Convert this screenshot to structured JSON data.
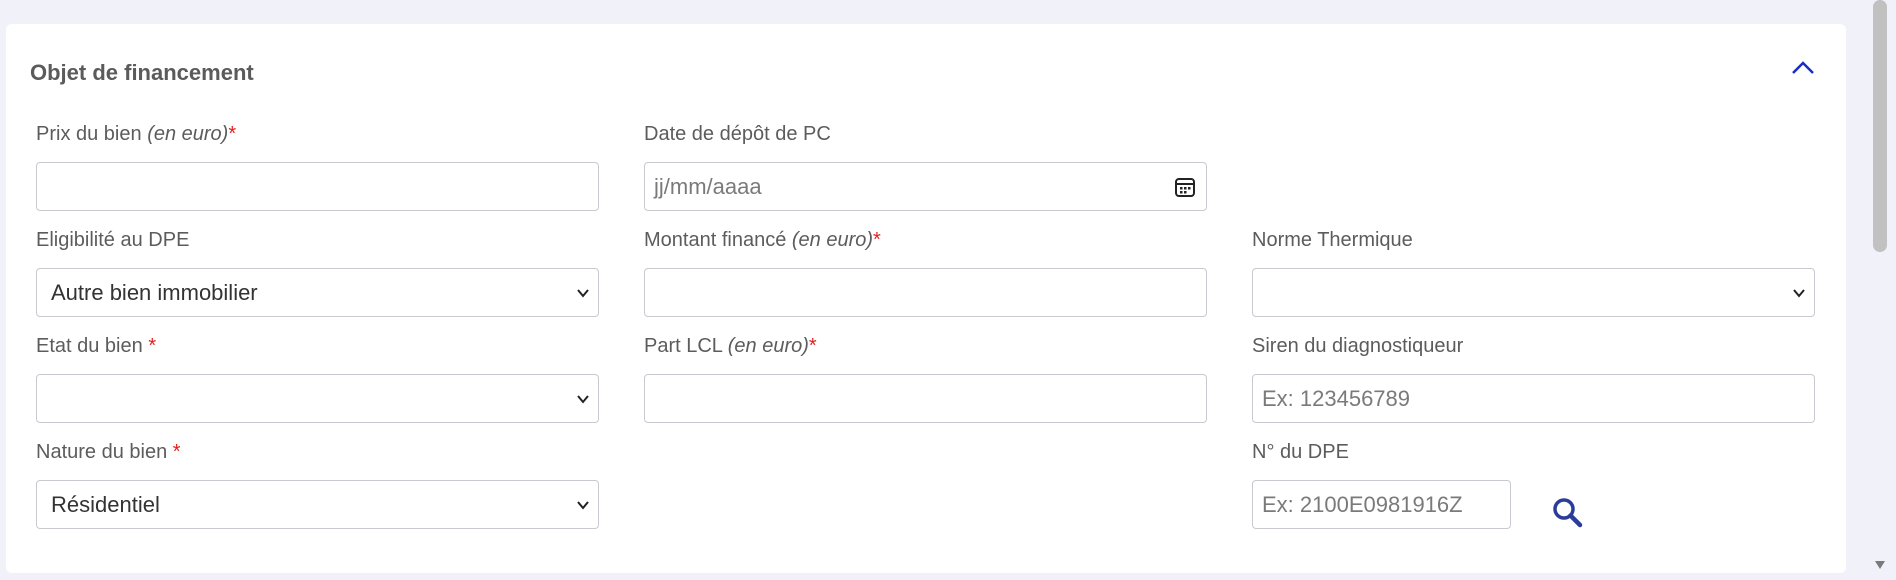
{
  "section": {
    "title": "Objet de financement"
  },
  "fields": {
    "prix_du_bien": {
      "label": "Prix du bien",
      "unit": "(en euro)",
      "required_mark": "*",
      "value": ""
    },
    "date_depot_pc": {
      "label": "Date de dépôt de PC",
      "placeholder": "jj/mm/aaaa"
    },
    "eligibilite_dpe": {
      "label": "Eligibilité au DPE",
      "selected": "Autre bien immobilier"
    },
    "montant_finance": {
      "label": "Montant financé",
      "unit": "(en euro)",
      "required_mark": "*",
      "value": ""
    },
    "norme_thermique": {
      "label": "Norme Thermique",
      "selected": ""
    },
    "etat_du_bien": {
      "label": "Etat du bien",
      "required_mark": "*",
      "selected": ""
    },
    "part_lcl": {
      "label": "Part LCL",
      "unit": "(en euro)",
      "required_mark": "*",
      "value": ""
    },
    "siren_diagnostiqueur": {
      "label": "Siren du diagnostiqueur",
      "placeholder": "Ex: 123456789"
    },
    "nature_du_bien": {
      "label": "Nature du bien",
      "required_mark": "*",
      "selected": "Résidentiel"
    },
    "numero_dpe": {
      "label": "N° du DPE",
      "placeholder": "Ex: 2100E0981916Z"
    }
  },
  "icons": {
    "collapse": "chevron-up-icon",
    "calendar": "calendar-icon",
    "select_arrow": "chevron-down-icon",
    "search": "search-icon"
  },
  "colors": {
    "accent": "#1a2dc4",
    "search_icon": "#2b3c9b",
    "required": "#e0201e",
    "label": "#5c5c5c",
    "border": "#c9c9cf",
    "background": "#f1f1fa"
  }
}
